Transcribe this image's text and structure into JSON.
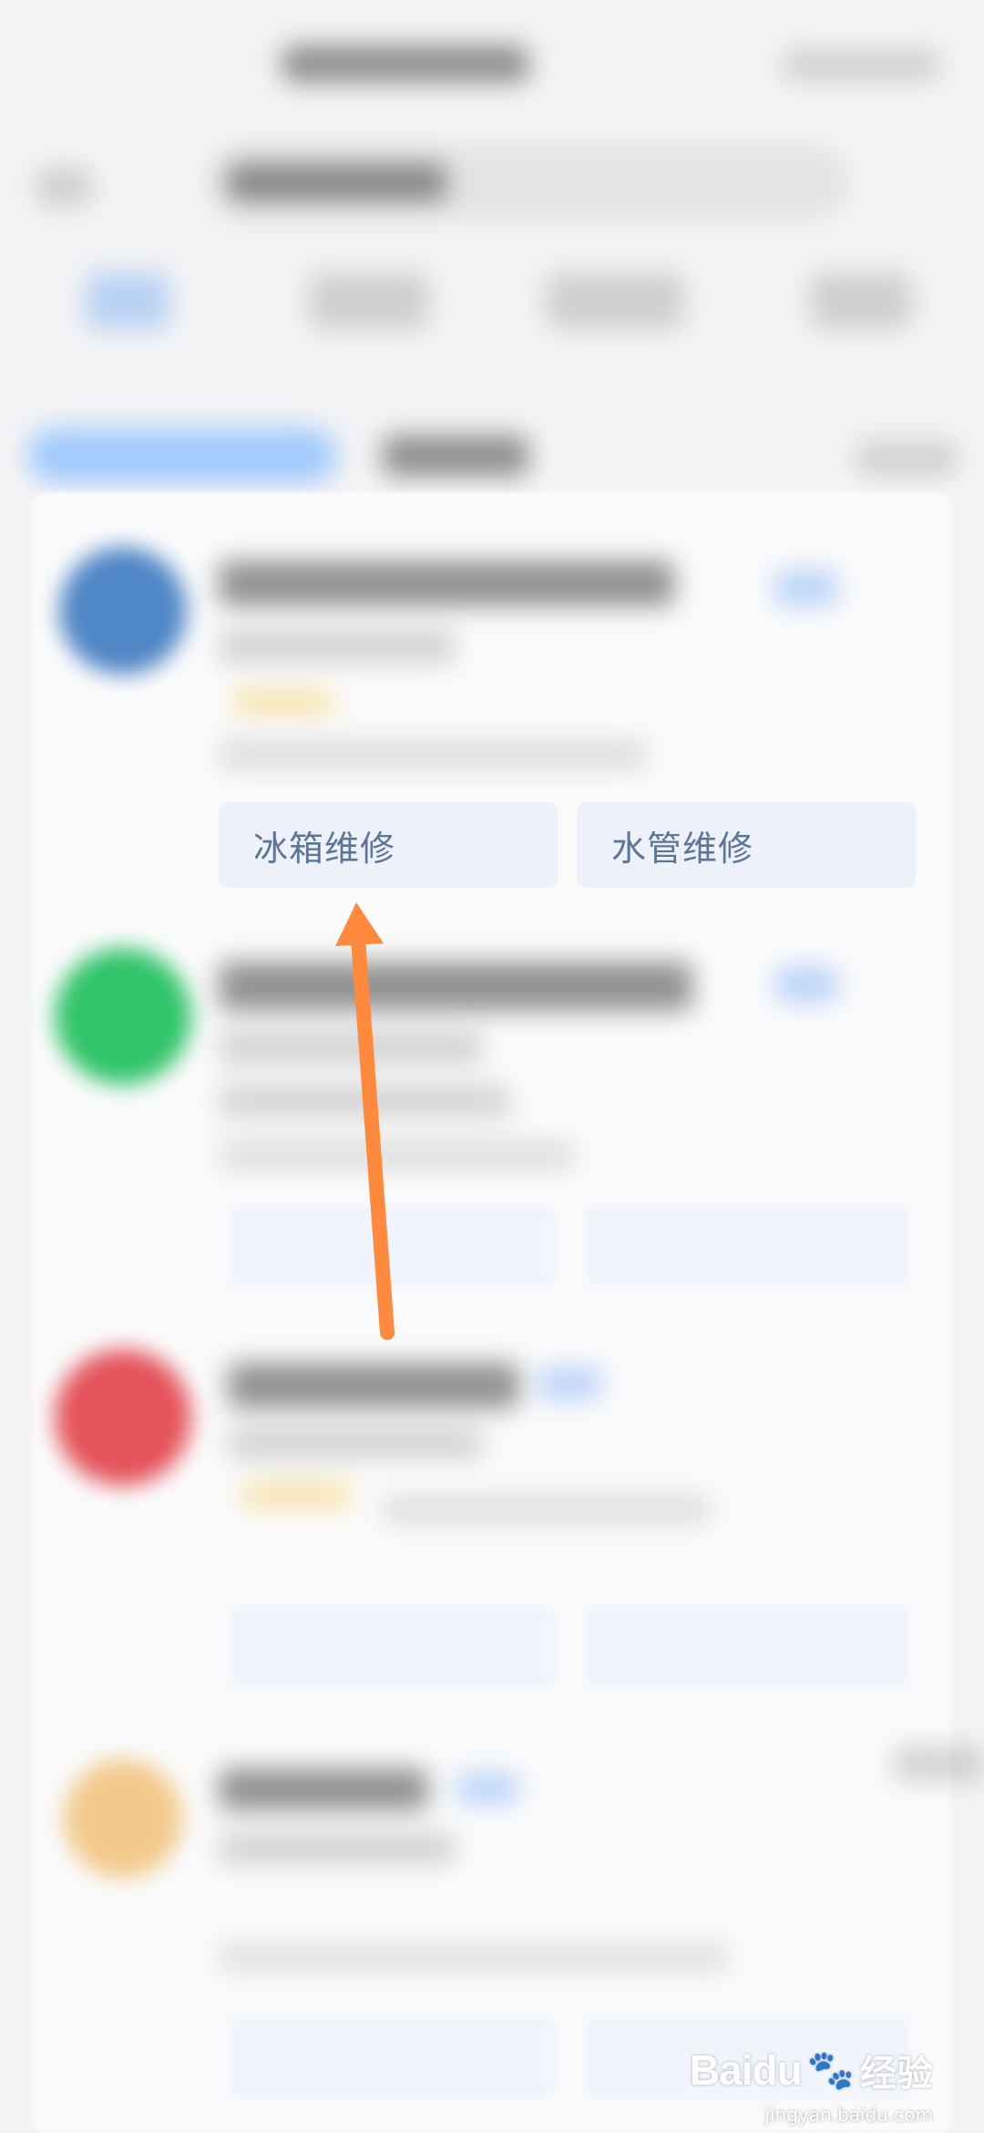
{
  "service_tags": {
    "first": "冰箱维修",
    "second": "水管维修"
  },
  "watermark": {
    "logo": "Baidu",
    "logo_cn": "经验",
    "url": "jingyan.baidu.com"
  },
  "colors": {
    "accent_blue": "#8ec0ff",
    "tag_text": "#5d7597",
    "tag_bg": "#edf2fa",
    "arrow": "#ff8a3d",
    "avatar_1": "#4f86c6",
    "avatar_2": "#31c46a",
    "avatar_3": "#e4535b",
    "avatar_4": "#f2c98a"
  }
}
